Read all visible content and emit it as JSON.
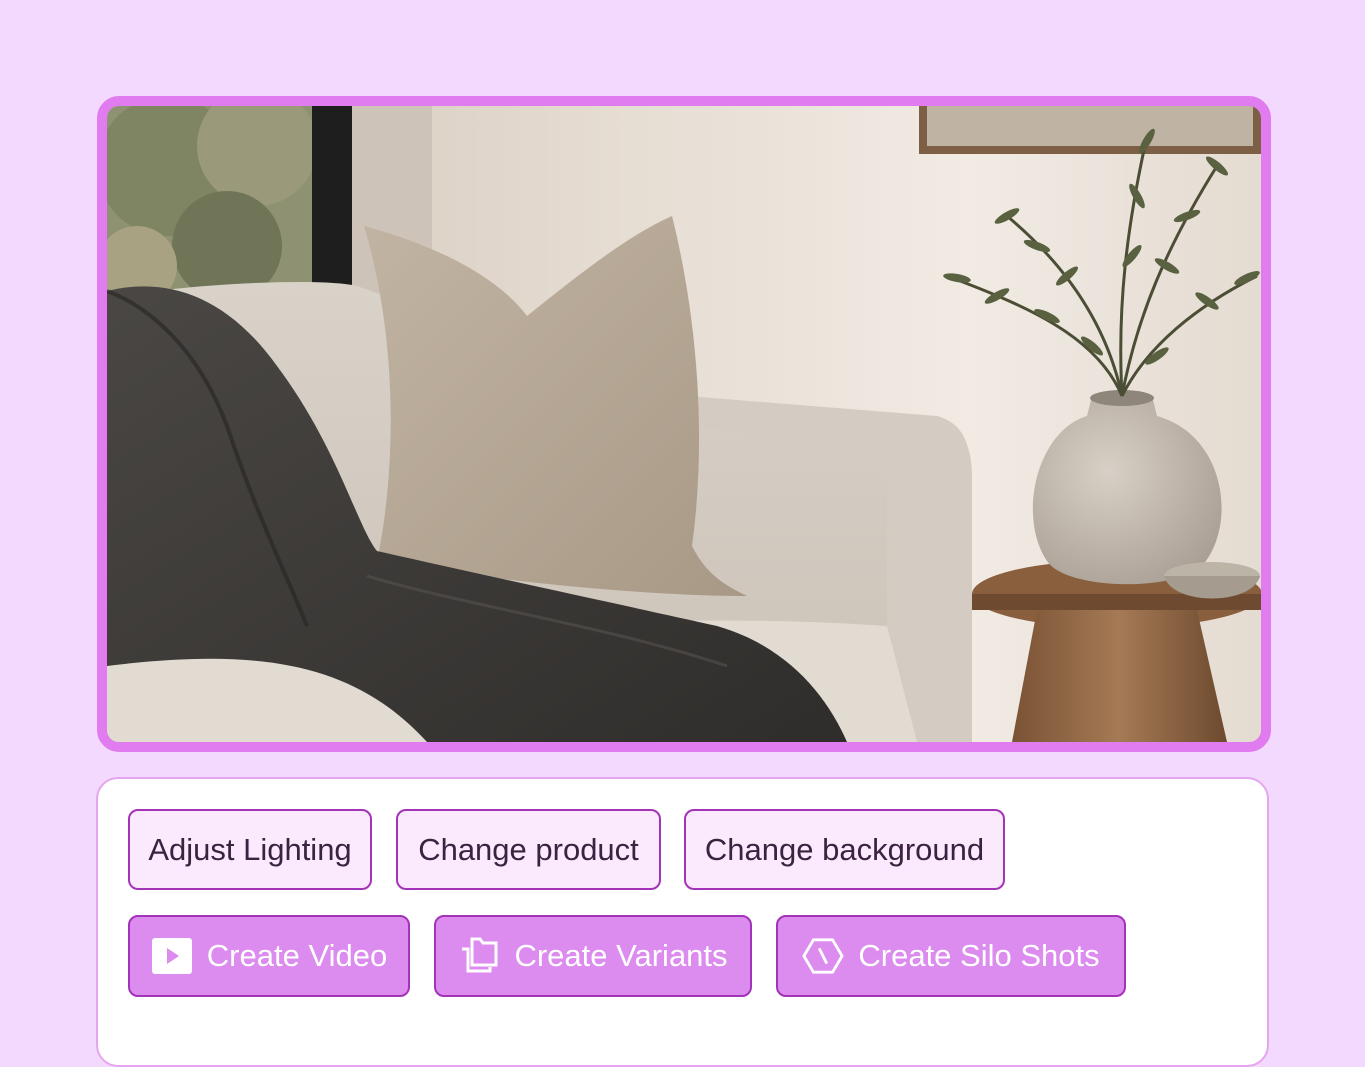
{
  "hero_image": {
    "subject": "living-room-sofa-scene"
  },
  "suggestions": [
    {
      "label": "Adjust Lighting"
    },
    {
      "label": "Change product"
    },
    {
      "label": "Change background"
    }
  ],
  "actions": [
    {
      "label": "Create Video",
      "icon": "play-icon"
    },
    {
      "label": "Create Variants",
      "icon": "stacked-copies-icon"
    },
    {
      "label": "Create Silo Shots",
      "icon": "hexagon-slash-icon"
    }
  ],
  "colors": {
    "background": "#f3d9fd",
    "frame_border": "#e07cf0",
    "chip_border": "#a334b8",
    "chip_fill": "#fbe9fe",
    "action_fill": "#dc8bee"
  }
}
